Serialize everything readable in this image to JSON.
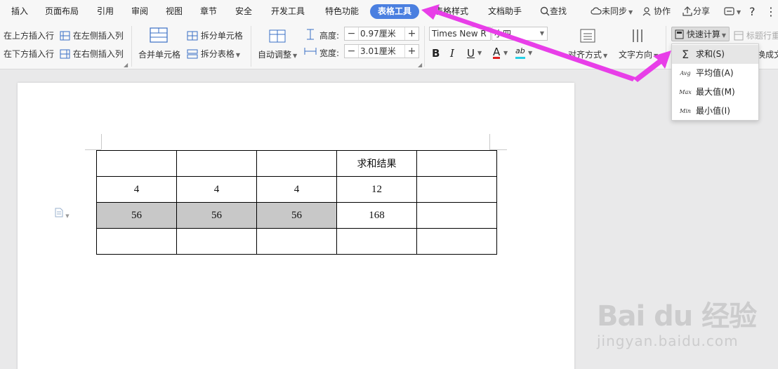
{
  "tabs": {
    "items": [
      "插入",
      "页面布局",
      "引用",
      "审阅",
      "视图",
      "章节",
      "安全",
      "开发工具",
      "特色功能",
      "表格工具",
      "表格样式",
      "文档助手"
    ],
    "active": "表格工具"
  },
  "topright": {
    "search": "查找",
    "sync": "未同步",
    "collab": "协作",
    "share": "分享",
    "help": "?"
  },
  "ribbon": {
    "insert_above": "在上方插入行",
    "insert_below": "在下方插入行",
    "insert_left": "在左侧插入列",
    "insert_right": "在右侧插入列",
    "merge_cells": "合并单元格",
    "split_cells": "拆分单元格",
    "split_table": "拆分表格",
    "auto_fit": "自动调整",
    "height_label": "高度:",
    "height_value": "0.97厘米",
    "width_label": "宽度:",
    "width_value": "3.01厘米",
    "font_name": "Times New R",
    "font_size": "小四",
    "align": "对齐方式",
    "text_dir": "文字方向",
    "quick_calc": "快速计算",
    "title_row": "标题行重",
    "convert": "换成文"
  },
  "dropdown": {
    "items": [
      {
        "icon": "Σ",
        "label": "求和(S)"
      },
      {
        "icon": "Avg",
        "label": "平均值(A)"
      },
      {
        "icon": "Max",
        "label": "最大值(M)"
      },
      {
        "icon": "Min",
        "label": "最小值(I)"
      }
    ]
  },
  "table": {
    "rows": [
      [
        "",
        "",
        "",
        "求和结果",
        ""
      ],
      [
        "4",
        "4",
        "4",
        "12",
        ""
      ],
      [
        "56",
        "56",
        "56",
        "168",
        ""
      ],
      [
        "",
        "",
        "",
        "",
        ""
      ]
    ]
  },
  "watermark": {
    "logo": "Bai du 经验",
    "url": "jingyan.baidu.com"
  },
  "colors": {
    "active_tab": "#4a7fe0",
    "arrow": "#e83ee8",
    "selected_cell": "#c8c8c8"
  }
}
